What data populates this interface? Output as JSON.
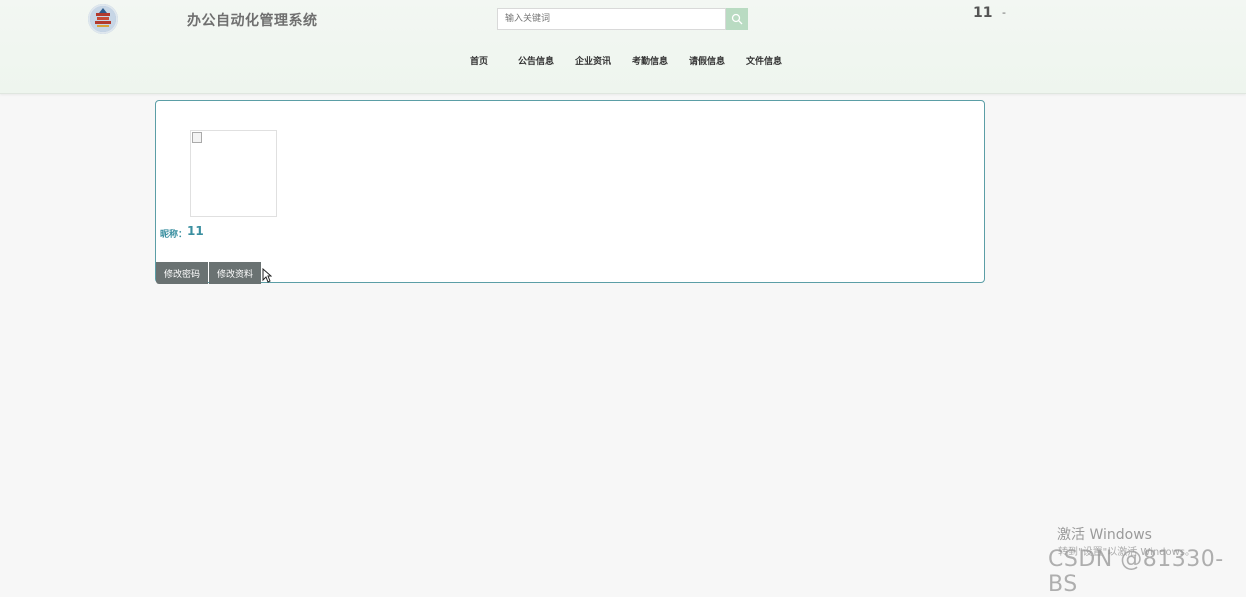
{
  "header": {
    "logo_icon": "temple-emblem-icon",
    "title": "办公自动化管理系统",
    "search_placeholder": "输入关键词",
    "search_icon": "search-icon",
    "user_name": "11",
    "user_dash": "-"
  },
  "nav": {
    "home": "首页",
    "announcements": "公告信息",
    "enterprise_news": "企业资讯",
    "attendance": "考勤信息",
    "leave": "请假信息",
    "files": "文件信息"
  },
  "profile": {
    "nickname_label": "昵称：",
    "nickname_value": "11",
    "change_password_label": "修改密码",
    "edit_profile_label": "修改资料"
  },
  "overlay": {
    "activate_title": "激活 Windows",
    "activate_sub": "转到\"设置\"以激活 Windows。",
    "watermark": "CSDN @81330-BS"
  },
  "colors": {
    "accent": "#3a8fa0",
    "button_bg": "#6a7272",
    "search_button_bg": "#b9dbc2",
    "card_border": "#5b9ea6"
  }
}
